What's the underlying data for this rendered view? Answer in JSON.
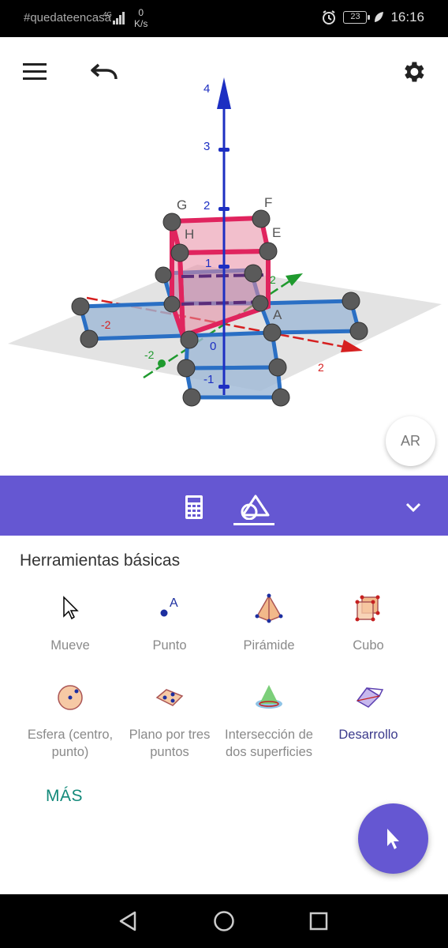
{
  "status_bar": {
    "carrier": "#quedateencasa",
    "network": "4G",
    "speed_value": "0",
    "speed_unit": "K/s",
    "battery": "23",
    "time": "16:16"
  },
  "toolbar": {
    "menu_icon": "hamburger-icon",
    "undo_icon": "undo-icon",
    "settings_icon": "gear-icon"
  },
  "graphics": {
    "axis_labels": {
      "z": [
        "4",
        "3",
        "2",
        "1",
        "0",
        "-1"
      ],
      "x": [
        "2",
        "-2"
      ],
      "y": [
        "2",
        "-2"
      ]
    },
    "point_labels": [
      "G",
      "F",
      "H",
      "E",
      "A"
    ],
    "ar_label": "AR"
  },
  "tabs": [
    {
      "name": "algebra",
      "icon": "calculator-icon"
    },
    {
      "name": "tools",
      "icon": "tools-icon"
    }
  ],
  "panel": {
    "title": "Herramientas básicas",
    "tools": [
      {
        "label": "Mueve",
        "icon": "arrow-pointer-icon"
      },
      {
        "label": "Punto",
        "icon": "point-icon"
      },
      {
        "label": "Pirámide",
        "icon": "pyramid-icon"
      },
      {
        "label": "Cubo",
        "icon": "cube-icon"
      },
      {
        "label": "Esfera (centro, punto)",
        "icon": "sphere-icon"
      },
      {
        "label": "Plano por tres puntos",
        "icon": "plane-three-points-icon"
      },
      {
        "label": "Intersección de dos superficies",
        "icon": "intersection-icon"
      },
      {
        "label": "Desarrollo",
        "icon": "net-icon"
      }
    ],
    "more_label": "MÁS"
  },
  "colors": {
    "accent": "#6557d2",
    "more_link": "#12897a",
    "selected_label": "#3b3a8c"
  }
}
